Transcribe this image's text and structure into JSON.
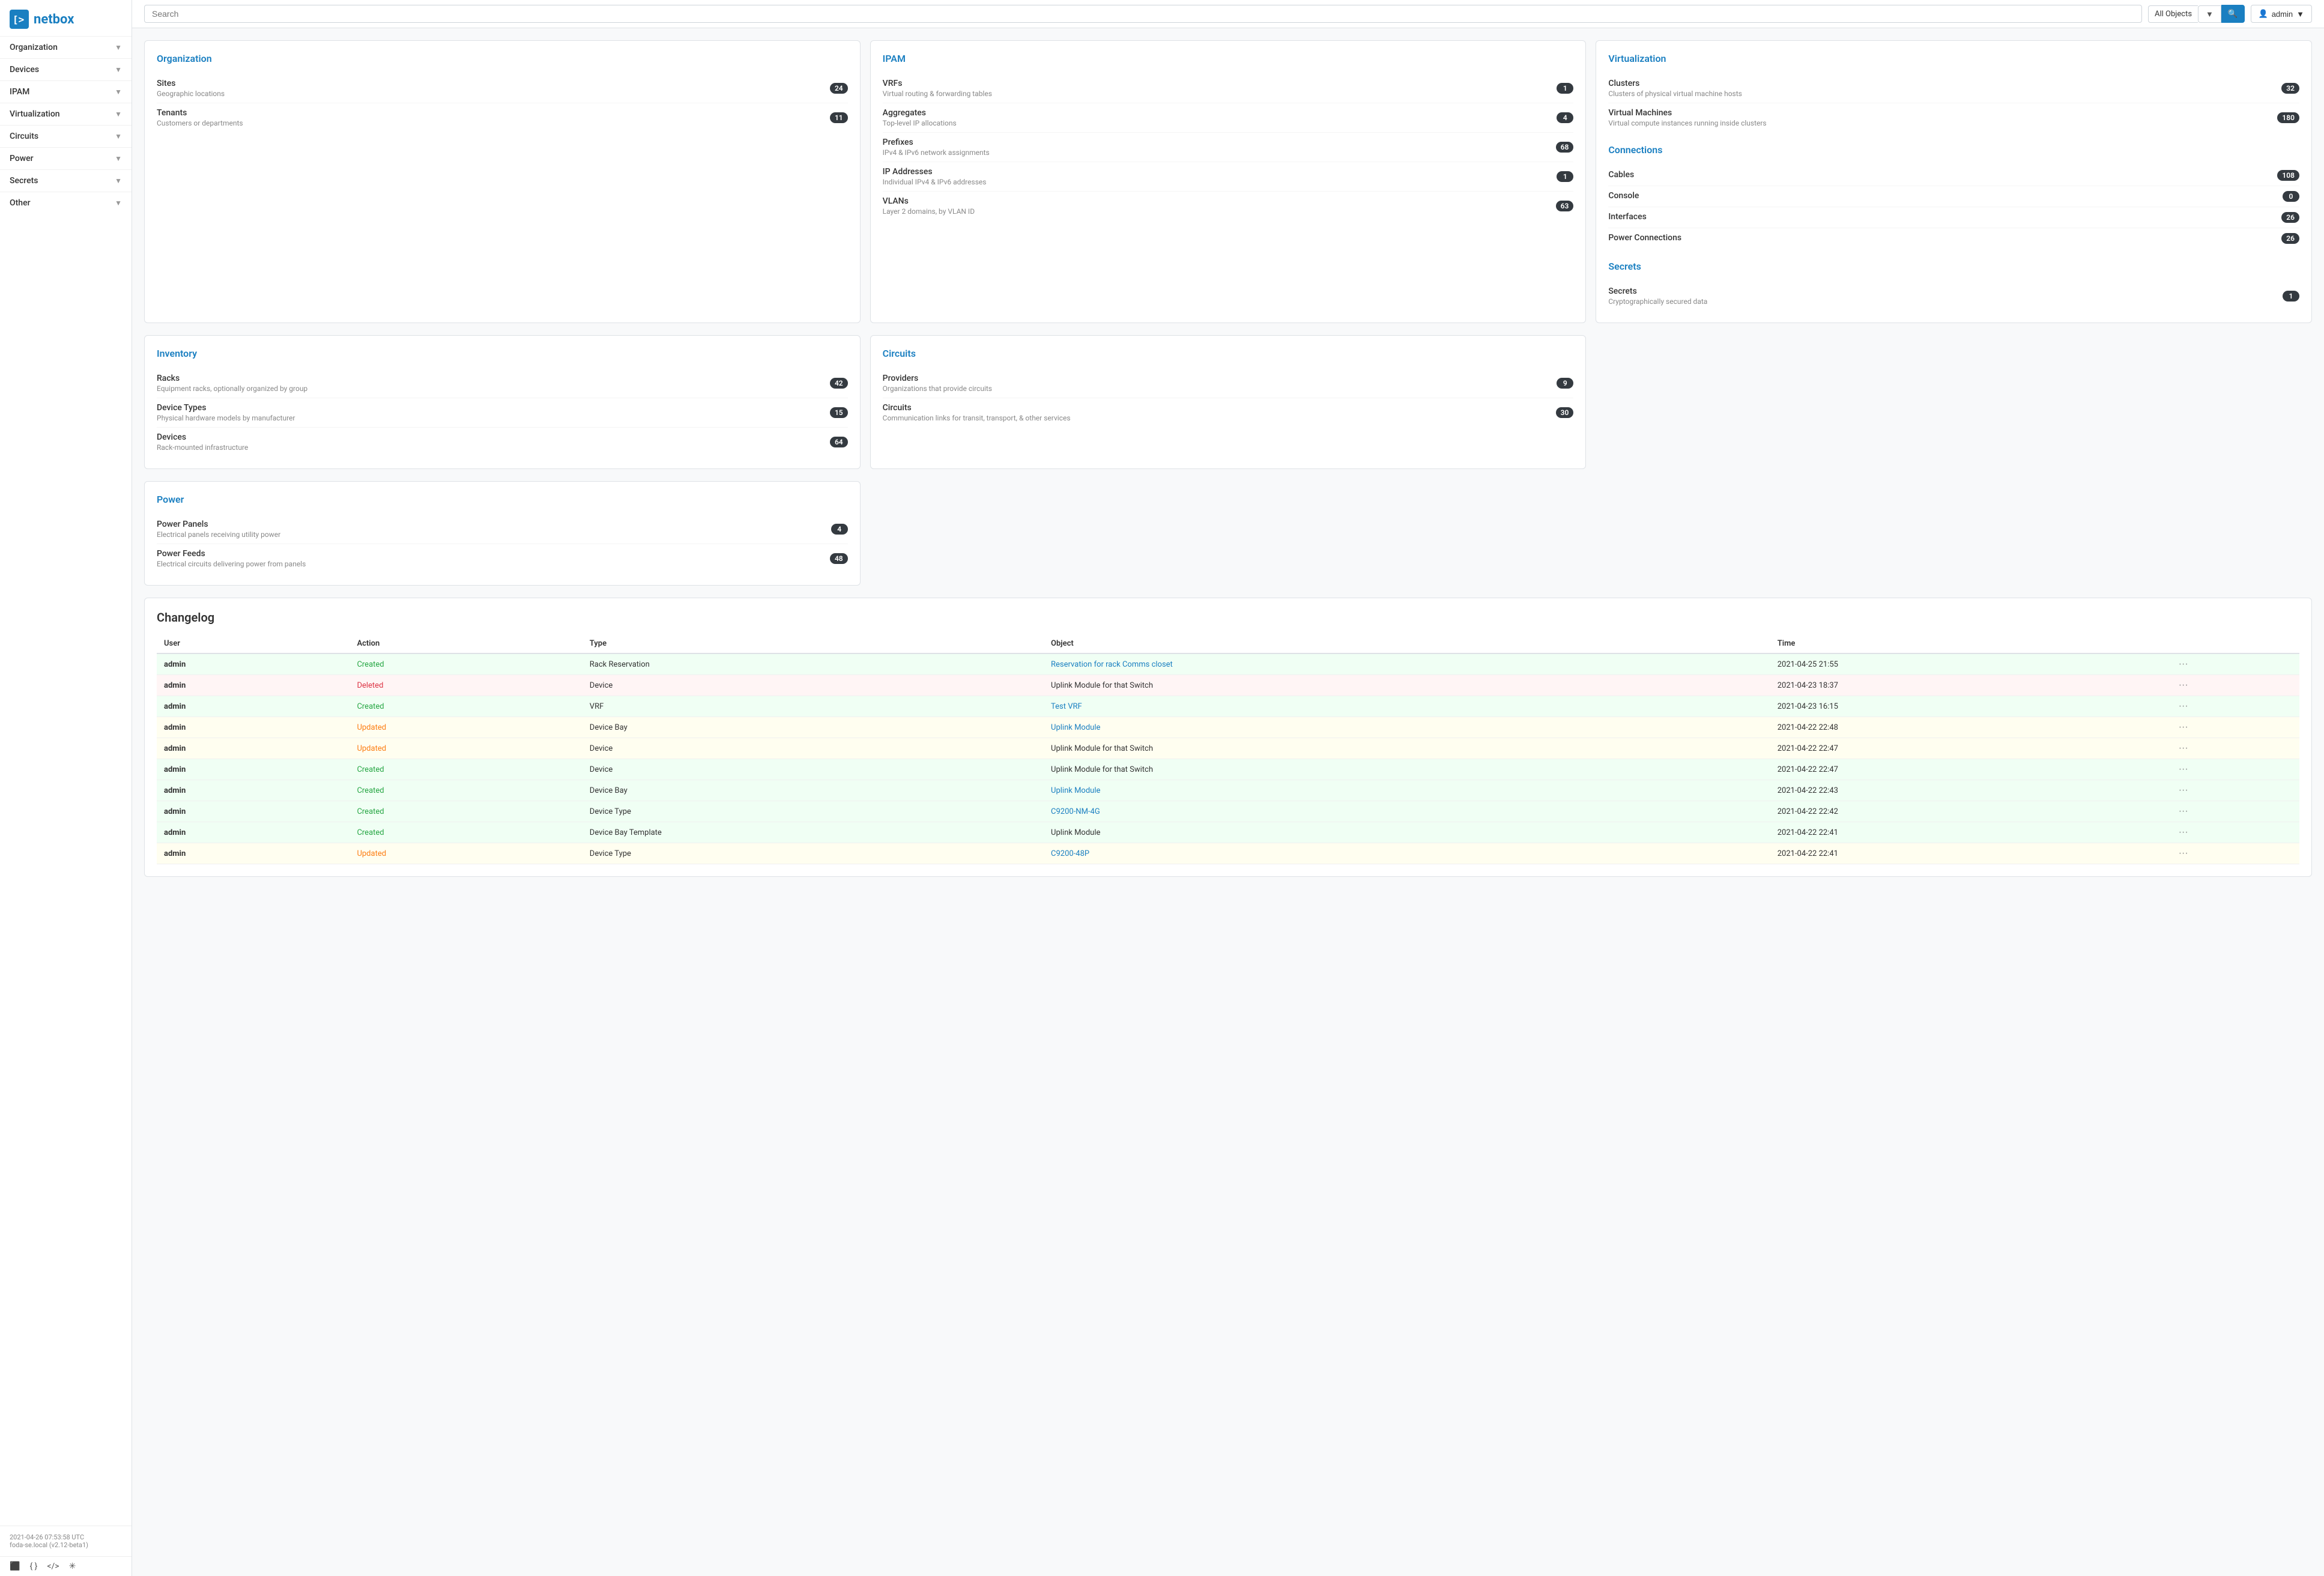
{
  "app": {
    "name": "netbox"
  },
  "header": {
    "search_placeholder": "Search",
    "all_objects": "All Objects",
    "admin_label": "admin"
  },
  "sidebar": {
    "items": [
      {
        "id": "organization",
        "label": "Organization"
      },
      {
        "id": "devices",
        "label": "Devices"
      },
      {
        "id": "ipam",
        "label": "IPAM"
      },
      {
        "id": "virtualization",
        "label": "Virtualization"
      },
      {
        "id": "circuits",
        "label": "Circuits"
      },
      {
        "id": "power",
        "label": "Power"
      },
      {
        "id": "secrets",
        "label": "Secrets"
      },
      {
        "id": "other",
        "label": "Other"
      }
    ],
    "footer_text": "2021-04-26 07:53:58 UTC",
    "footer_subtext": "foda-se.local (v2.12-beta1)"
  },
  "organization_card": {
    "title": "Organization",
    "items": [
      {
        "name": "Sites",
        "desc": "Geographic locations",
        "count": 24
      },
      {
        "name": "Tenants",
        "desc": "Customers or departments",
        "count": 11
      }
    ]
  },
  "inventory_card": {
    "title": "Inventory",
    "items": [
      {
        "name": "Racks",
        "desc": "Equipment racks, optionally organized by group",
        "count": 42
      },
      {
        "name": "Device Types",
        "desc": "Physical hardware models by manufacturer",
        "count": 15
      },
      {
        "name": "Devices",
        "desc": "Rack-mounted infrastructure",
        "count": 64
      }
    ]
  },
  "power_card": {
    "title": "Power",
    "items": [
      {
        "name": "Power Panels",
        "desc": "Electrical panels receiving utility power",
        "count": 4
      },
      {
        "name": "Power Feeds",
        "desc": "Electrical circuits delivering power from panels",
        "count": 48
      }
    ]
  },
  "ipam_card": {
    "title": "IPAM",
    "items": [
      {
        "name": "VRFs",
        "desc": "Virtual routing & forwarding tables",
        "count": 1
      },
      {
        "name": "Aggregates",
        "desc": "Top-level IP allocations",
        "count": 4
      },
      {
        "name": "Prefixes",
        "desc": "IPv4 & IPv6 network assignments",
        "count": 68
      },
      {
        "name": "IP Addresses",
        "desc": "Individual IPv4 & IPv6 addresses",
        "count": 1
      },
      {
        "name": "VLANs",
        "desc": "Layer 2 domains, by VLAN ID",
        "count": 63
      }
    ]
  },
  "circuits_card": {
    "title": "Circuits",
    "items": [
      {
        "name": "Providers",
        "desc": "Organizations that provide circuits",
        "count": 9
      },
      {
        "name": "Circuits",
        "desc": "Communication links for transit, transport, & other services",
        "count": 30
      }
    ]
  },
  "virtualization_card": {
    "title": "Virtualization",
    "items": [
      {
        "name": "Clusters",
        "desc": "Clusters of physical virtual machine hosts",
        "count": 32
      },
      {
        "name": "Virtual Machines",
        "desc": "Virtual compute instances running inside clusters",
        "count": 180
      }
    ]
  },
  "connections_card": {
    "title": "Connections",
    "items": [
      {
        "name": "Cables",
        "count": 108
      },
      {
        "name": "Console",
        "count": 0
      },
      {
        "name": "Interfaces",
        "count": 26
      },
      {
        "name": "Power Connections",
        "count": 26
      }
    ]
  },
  "secrets_card": {
    "title": "Secrets",
    "items": [
      {
        "name": "Secrets",
        "desc": "Cryptographically secured data",
        "count": 1
      }
    ]
  },
  "changelog": {
    "title": "Changelog",
    "columns": [
      "User",
      "Action",
      "Type",
      "Object",
      "Time"
    ],
    "rows": [
      {
        "user": "admin",
        "action": "Created",
        "action_type": "created",
        "type": "Rack Reservation",
        "object": "Reservation for rack Comms closet",
        "object_link": true,
        "time": "2021-04-25 21:55",
        "row_class": "row-created"
      },
      {
        "user": "admin",
        "action": "Deleted",
        "action_type": "deleted",
        "type": "Device",
        "object": "Uplink Module for that Switch",
        "object_link": false,
        "time": "2021-04-23 18:37",
        "row_class": "row-deleted"
      },
      {
        "user": "admin",
        "action": "Created",
        "action_type": "created",
        "type": "VRF",
        "object": "Test VRF",
        "object_link": true,
        "time": "2021-04-23 16:15",
        "row_class": "row-created"
      },
      {
        "user": "admin",
        "action": "Updated",
        "action_type": "updated",
        "type": "Device Bay",
        "object": "Uplink Module",
        "object_link": true,
        "time": "2021-04-22 22:48",
        "row_class": "row-updated"
      },
      {
        "user": "admin",
        "action": "Updated",
        "action_type": "updated",
        "type": "Device",
        "object": "Uplink Module for that Switch",
        "object_link": false,
        "time": "2021-04-22 22:47",
        "row_class": "row-updated"
      },
      {
        "user": "admin",
        "action": "Created",
        "action_type": "created",
        "type": "Device",
        "object": "Uplink Module for that Switch",
        "object_link": false,
        "time": "2021-04-22 22:47",
        "row_class": "row-created"
      },
      {
        "user": "admin",
        "action": "Created",
        "action_type": "created",
        "type": "Device Bay",
        "object": "Uplink Module",
        "object_link": true,
        "time": "2021-04-22 22:43",
        "row_class": "row-created"
      },
      {
        "user": "admin",
        "action": "Created",
        "action_type": "created",
        "type": "Device Type",
        "object": "C9200-NM-4G",
        "object_link": true,
        "time": "2021-04-22 22:42",
        "row_class": "row-created"
      },
      {
        "user": "admin",
        "action": "Created",
        "action_type": "created",
        "type": "Device Bay Template",
        "object": "Uplink Module",
        "object_link": false,
        "time": "2021-04-22 22:41",
        "row_class": "row-created"
      },
      {
        "user": "admin",
        "action": "Updated",
        "action_type": "updated",
        "type": "Device Type",
        "object": "C9200-48P",
        "object_link": true,
        "time": "2021-04-22 22:41",
        "row_class": "row-updated"
      }
    ]
  }
}
